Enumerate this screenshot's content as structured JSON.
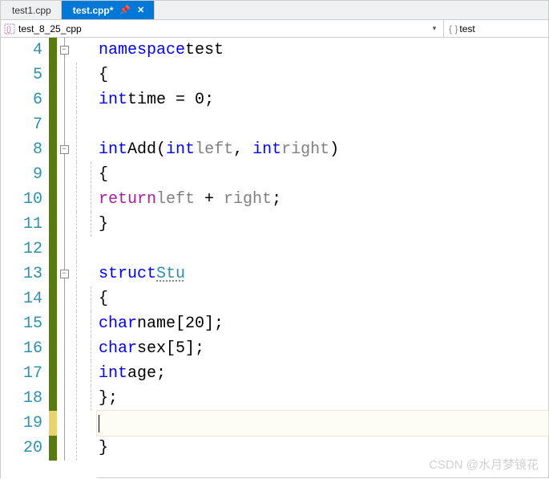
{
  "tabs": {
    "inactive": "test1.cpp",
    "active": "test.cpp*"
  },
  "nav": {
    "scope": "test_8_25_cpp",
    "member": "test",
    "brace_icon": "{ }"
  },
  "lines": {
    "l4": {
      "num": "4"
    },
    "l5": {
      "num": "5"
    },
    "l6": {
      "num": "6"
    },
    "l7": {
      "num": "7"
    },
    "l8": {
      "num": "8"
    },
    "l9": {
      "num": "9"
    },
    "l10": {
      "num": "10"
    },
    "l11": {
      "num": "11"
    },
    "l12": {
      "num": "12"
    },
    "l13": {
      "num": "13"
    },
    "l14": {
      "num": "14"
    },
    "l15": {
      "num": "15"
    },
    "l16": {
      "num": "16"
    },
    "l17": {
      "num": "17"
    },
    "l18": {
      "num": "18"
    },
    "l19": {
      "num": "19"
    },
    "l20": {
      "num": "20"
    }
  },
  "code": {
    "namespace_kw": "namespace",
    "namespace_name": "test",
    "open_brace": "{",
    "close_brace": "}",
    "int_kw": "int",
    "char_kw": "char",
    "struct_kw": "struct",
    "return_kw": "return",
    "time_ident": "time",
    "eq": " = ",
    "zero": "0",
    "semi": ";",
    "add_ident": "Add",
    "lparen": "(",
    "rparen": ")",
    "left_param": "left",
    "right_param": "right",
    "comma": ", ",
    "plus": " + ",
    "stu_ident": "Stu",
    "name_ident": "name",
    "name_dim": "[20]",
    "sex_ident": "sex",
    "sex_dim": "[5]",
    "age_ident": "age",
    "struct_end": "};"
  },
  "fold": {
    "minus": "−"
  },
  "watermark": "CSDN @水月梦镜花"
}
